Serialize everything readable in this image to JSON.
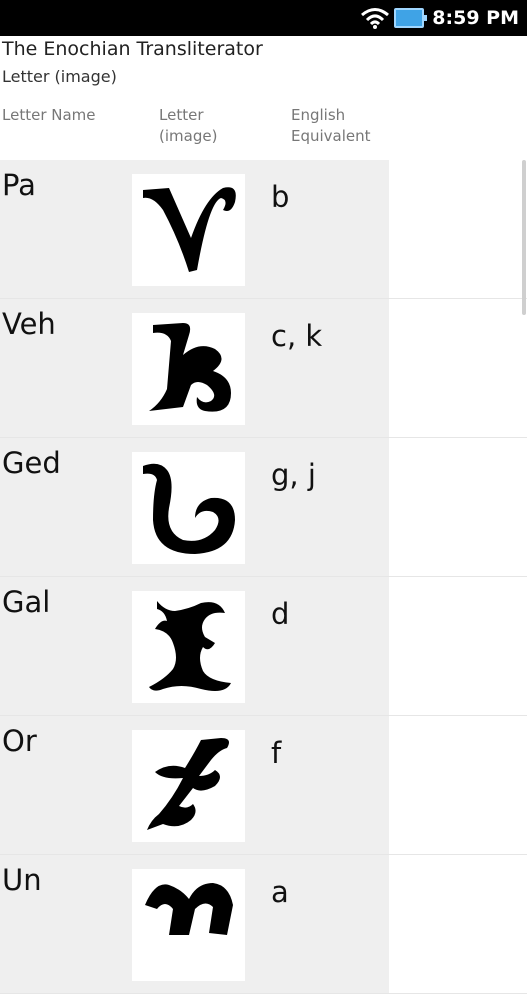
{
  "status_bar": {
    "time": "8:59 PM",
    "icons": [
      "wifi-icon",
      "battery-icon"
    ],
    "battery_color": "#3fa3e6"
  },
  "app": {
    "title": "The Enochian Transliterator",
    "subtitle": "Letter (image)"
  },
  "table": {
    "headers": {
      "name": "Letter Name",
      "image": "Letter (image)",
      "english": "English Equivalent"
    },
    "rows": [
      {
        "name": "Pa",
        "glyph": "pa-letter-icon",
        "english": "b"
      },
      {
        "name": "Veh",
        "glyph": "veh-letter-icon",
        "english": "c, k"
      },
      {
        "name": "Ged",
        "glyph": "ged-letter-icon",
        "english": "g, j"
      },
      {
        "name": "Gal",
        "glyph": "gal-letter-icon",
        "english": "d"
      },
      {
        "name": "Or",
        "glyph": "or-letter-icon",
        "english": "f"
      },
      {
        "name": "Un",
        "glyph": "un-letter-icon",
        "english": "a"
      }
    ]
  },
  "colors": {
    "row_background": "#efefef",
    "header_text": "#777777"
  }
}
